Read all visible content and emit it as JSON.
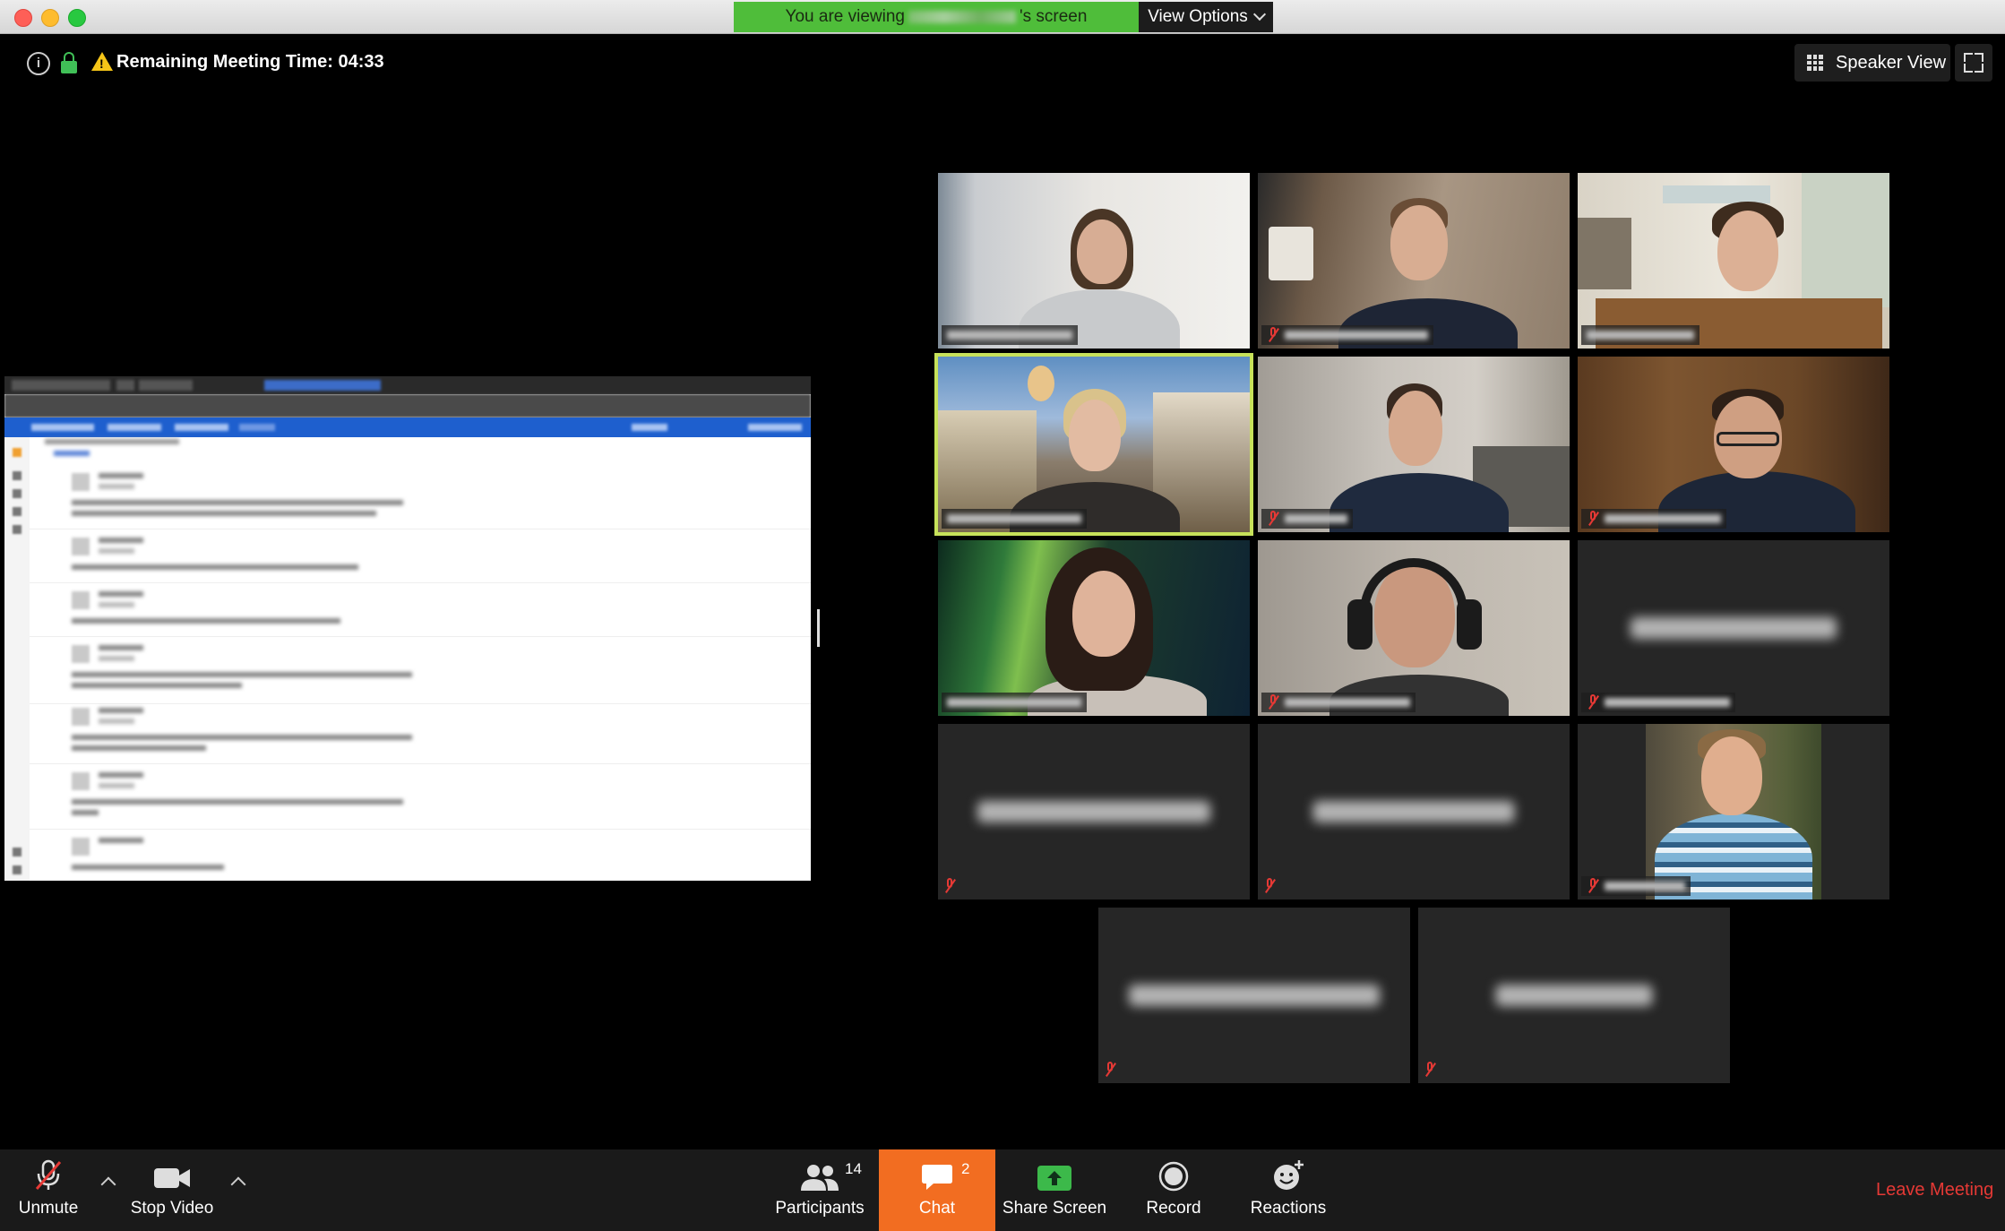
{
  "titlebar": {
    "viewing_prefix": "You are viewing",
    "viewing_suffix": "'s screen",
    "view_options": "View Options"
  },
  "topbar": {
    "remaining_time": "Remaining Meeting Time: 04:33",
    "speaker_view": "Speaker View"
  },
  "participants_grid": {
    "rows": [
      [
        "video-woman-sofa",
        "video-man-wall",
        "video-man-office"
      ],
      [
        "video-man-castle-bg-active",
        "video-man-chair",
        "video-man-glasses"
      ],
      [
        "video-woman-aurora",
        "video-man-headphones",
        "name-only"
      ],
      [
        "name-only",
        "name-only",
        "photo-man-striped-shirt"
      ],
      [
        "name-only",
        "name-only"
      ]
    ],
    "active_speaker_color": "#c7e25a",
    "muted_icon_color": "#e53935"
  },
  "toolbar": {
    "unmute": "Unmute",
    "stop_video": "Stop Video",
    "participants": "Participants",
    "participants_count": "14",
    "chat": "Chat",
    "chat_count": "2",
    "share_screen": "Share Screen",
    "record": "Record",
    "reactions": "Reactions",
    "leave_meeting": "Leave Meeting"
  },
  "colors": {
    "share_banner": "#4fbd3a",
    "chat_accent": "#f26d21",
    "leave_red": "#e53935"
  }
}
